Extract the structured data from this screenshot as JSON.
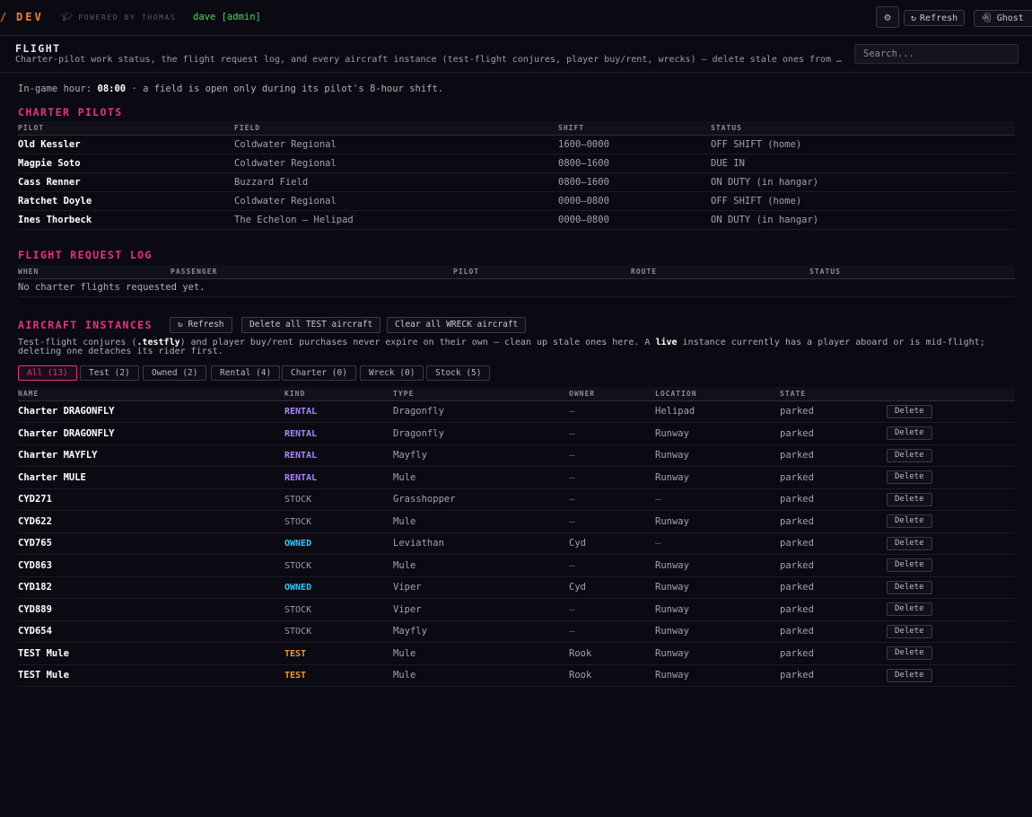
{
  "topbar": {
    "brand_slash": "/",
    "brand": "DEV",
    "powered": "POWERED BY THOMAS",
    "user": "dave [admin]",
    "refresh_label": "Refresh",
    "ghost_label": "Ghost"
  },
  "header": {
    "title": "FLIGHT",
    "subtitle": "Charter-pilot work status, the flight request log, and every aircraft instance (test-flight conjures, player buy/rent, wrecks) — delete stale ones from …",
    "search_placeholder": "Search..."
  },
  "hour": {
    "prefix": "In-game hour:",
    "value": "08:00",
    "suffix": "· a field is open only during its pilot's 8-hour shift."
  },
  "pilots": {
    "title": "CHARTER PILOTS",
    "columns": [
      "PILOT",
      "FIELD",
      "SHIFT",
      "STATUS"
    ],
    "rows": [
      [
        "Old Kessler",
        "Coldwater Regional",
        "1600–0000",
        "OFF SHIFT (home)"
      ],
      [
        "Magpie Soto",
        "Coldwater Regional",
        "0800–1600",
        "DUE IN"
      ],
      [
        "Cass Renner",
        "Buzzard Field",
        "0800–1600",
        "ON DUTY (in hangar)"
      ],
      [
        "Ratchet Doyle",
        "Coldwater Regional",
        "0000–0800",
        "OFF SHIFT (home)"
      ],
      [
        "Ines Thorbeck",
        "The Echelon — Helipad",
        "0000–0800",
        "ON DUTY (in hangar)"
      ]
    ]
  },
  "log": {
    "title": "FLIGHT REQUEST LOG",
    "columns": [
      "WHEN",
      "PASSENGER",
      "PILOT",
      "ROUTE",
      "STATUS"
    ],
    "empty": "No charter flights requested yet."
  },
  "aircraft": {
    "title": "AIRCRAFT INSTANCES",
    "refresh_label": "Refresh",
    "delete_test_label": "Delete all TEST aircraft",
    "clear_wreck_label": "Clear all WRECK aircraft",
    "note_1": "Test-flight conjures (",
    "note_cmd": ".testfly",
    "note_2": ") and player buy/rent purchases never expire on their own — clean up stale ones here. A ",
    "note_live": "live",
    "note_3": " instance currently has a player aboard or is mid-flight; deleting one detaches its rider first.",
    "filters": [
      "All (13)",
      "Test (2)",
      "Owned (2)",
      "Rental (4)",
      "Charter (0)",
      "Wreck (0)",
      "Stock (5)"
    ],
    "columns": [
      "NAME",
      "KIND",
      "TYPE",
      "OWNER",
      "LOCATION",
      "STATE"
    ],
    "delete_label": "Delete",
    "rows": [
      {
        "name": "Charter DRAGONFLY",
        "kind": "RENTAL",
        "type": "Dragonfly",
        "owner": "—",
        "location": "Helipad",
        "state": "parked"
      },
      {
        "name": "Charter DRAGONFLY",
        "kind": "RENTAL",
        "type": "Dragonfly",
        "owner": "—",
        "location": "Runway",
        "state": "parked"
      },
      {
        "name": "Charter MAYFLY",
        "kind": "RENTAL",
        "type": "Mayfly",
        "owner": "—",
        "location": "Runway",
        "state": "parked"
      },
      {
        "name": "Charter MULE",
        "kind": "RENTAL",
        "type": "Mule",
        "owner": "—",
        "location": "Runway",
        "state": "parked"
      },
      {
        "name": "CYD271",
        "kind": "STOCK",
        "type": "Grasshopper",
        "owner": "—",
        "location": "—",
        "state": "parked"
      },
      {
        "name": "CYD622",
        "kind": "STOCK",
        "type": "Mule",
        "owner": "—",
        "location": "Runway",
        "state": "parked"
      },
      {
        "name": "CYD765",
        "kind": "OWNED",
        "type": "Leviathan",
        "owner": "Cyd",
        "location": "—",
        "state": "parked"
      },
      {
        "name": "CYD863",
        "kind": "STOCK",
        "type": "Mule",
        "owner": "—",
        "location": "Runway",
        "state": "parked"
      },
      {
        "name": "CYD182",
        "kind": "OWNED",
        "type": "Viper",
        "owner": "Cyd",
        "location": "Runway",
        "state": "parked"
      },
      {
        "name": "CYD889",
        "kind": "STOCK",
        "type": "Viper",
        "owner": "—",
        "location": "Runway",
        "state": "parked"
      },
      {
        "name": "CYD654",
        "kind": "STOCK",
        "type": "Mayfly",
        "owner": "—",
        "location": "Runway",
        "state": "parked"
      },
      {
        "name": "TEST Mule",
        "kind": "TEST",
        "type": "Mule",
        "owner": "Rook",
        "location": "Runway",
        "state": "parked"
      },
      {
        "name": "TEST Mule",
        "kind": "TEST",
        "type": "Mule",
        "owner": "Rook",
        "location": "Runway",
        "state": "parked"
      }
    ]
  },
  "colors": {
    "background": "#0b0a12",
    "brand": "#f0823a",
    "section_title": "#e8318a",
    "user": "#4cd964",
    "rental": "#a985ff",
    "owned": "#38c5f0",
    "test": "#f0963a"
  },
  "icons": {
    "settings": "gear-icon",
    "refresh": "refresh-icon",
    "ghost": "ghost-icon",
    "powered": "graduation-cap-icon"
  }
}
